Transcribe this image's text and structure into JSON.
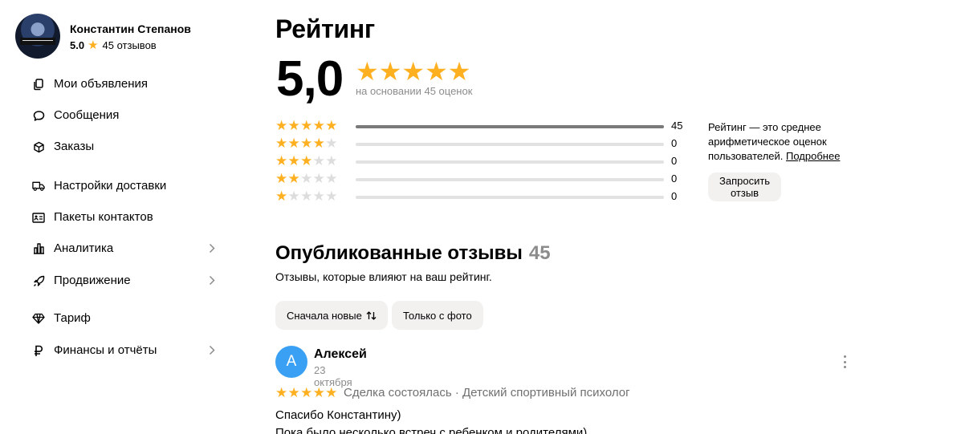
{
  "profile": {
    "name": "Константин Степанов",
    "rating": "5.0",
    "reviews": "45 отзывов"
  },
  "sidebar": {
    "items": [
      {
        "label": "Мои объявления",
        "icon": "listings-icon"
      },
      {
        "label": "Сообщения",
        "icon": "message-icon"
      },
      {
        "label": "Заказы",
        "icon": "box-icon"
      },
      {
        "label": "Настройки доставки",
        "icon": "truck-icon"
      },
      {
        "label": "Пакеты контактов",
        "icon": "contact-card-icon"
      },
      {
        "label": "Аналитика",
        "icon": "chart-icon"
      },
      {
        "label": "Продвижение",
        "icon": "rocket-icon"
      },
      {
        "label": "Тариф",
        "icon": "diamond-icon"
      },
      {
        "label": "Финансы и отчёты",
        "icon": "ruble-icon"
      }
    ]
  },
  "rating": {
    "title": "Рейтинг",
    "value": "5,0",
    "based_on": "на основании 45 оценок",
    "distribution": [
      {
        "stars": 5,
        "count": "45",
        "fraction": 1.0
      },
      {
        "stars": 4,
        "count": "0",
        "fraction": 0
      },
      {
        "stars": 3,
        "count": "0",
        "fraction": 0
      },
      {
        "stars": 2,
        "count": "0",
        "fraction": 0
      },
      {
        "stars": 1,
        "count": "0",
        "fraction": 0
      }
    ],
    "note_text": "Рейтинг — это среднее арифметическое оценок пользователей.",
    "note_link": "Подробнее",
    "request_button": "Запросить отзыв"
  },
  "reviews": {
    "title": "Опубликованные отзывы",
    "count": "45",
    "subtitle": "Отзывы, которые влияют на ваш рейтинг.",
    "sort_label": "Сначала новые",
    "filter_label": "Только с фото",
    "first": {
      "initial": "А",
      "author": "Алексей",
      "date": "23 октября",
      "stars": 5,
      "deal": "Сделка состоялась · Детский спортивный психолог",
      "text_line1": "Спасибо Константину)",
      "text_line2": "Пока было несколько встреч с ребенком и родителями)"
    }
  },
  "colors": {
    "star": "#ffb021",
    "star_off": "#dddddd",
    "bar_fill": "#7a7a7a",
    "avatar_blue": "#3aa0f3"
  }
}
